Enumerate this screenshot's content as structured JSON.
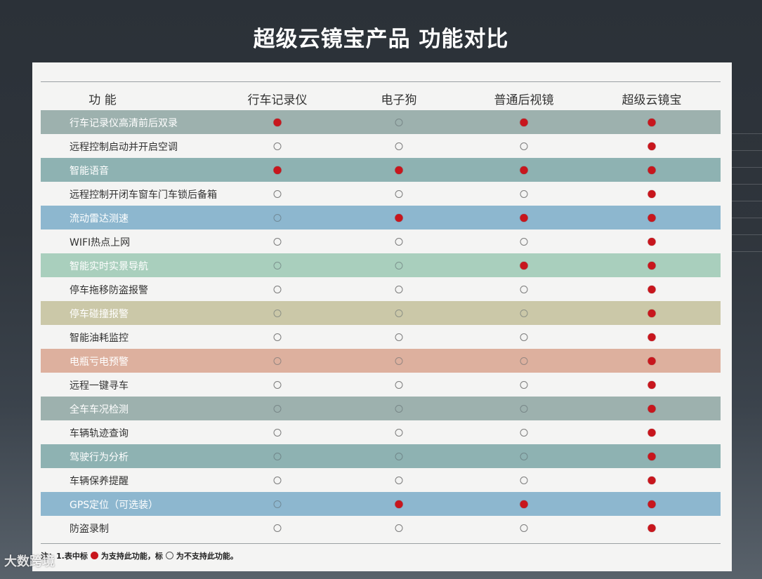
{
  "title": "超级云镜宝产品 功能对比",
  "table": {
    "columns": [
      "功 能",
      "行车记录仪",
      "电子狗",
      "普通后视镜",
      "超级云镜宝"
    ],
    "rows": [
      {
        "feature": "行车记录仪高清前后双录",
        "values": [
          true,
          false,
          true,
          true
        ],
        "color": "#9db1ae"
      },
      {
        "feature": "远程控制启动并开启空调",
        "values": [
          false,
          false,
          false,
          true
        ],
        "color": null
      },
      {
        "feature": "智能语音",
        "values": [
          true,
          true,
          true,
          true
        ],
        "color": "#8eb2b2"
      },
      {
        "feature": "远程控制开闭车窗车门车锁后备箱",
        "values": [
          false,
          false,
          false,
          true
        ],
        "color": null
      },
      {
        "feature": "流动雷达测速",
        "values": [
          false,
          true,
          true,
          true
        ],
        "color": "#8db7cf"
      },
      {
        "feature": "WIFI热点上网",
        "values": [
          false,
          false,
          false,
          true
        ],
        "color": null
      },
      {
        "feature": "智能实时实景导航",
        "values": [
          false,
          false,
          true,
          true
        ],
        "color": "#a9cfbd"
      },
      {
        "feature": "停车拖移防盗报警",
        "values": [
          false,
          false,
          false,
          true
        ],
        "color": null
      },
      {
        "feature": "停车碰撞报警",
        "values": [
          false,
          false,
          false,
          true
        ],
        "color": "#cbc8a8"
      },
      {
        "feature": "智能油耗监控",
        "values": [
          false,
          false,
          false,
          true
        ],
        "color": null
      },
      {
        "feature": "电瓶亏电预警",
        "values": [
          false,
          false,
          false,
          true
        ],
        "color": "#ddb09e"
      },
      {
        "feature": "远程一键寻车",
        "values": [
          false,
          false,
          false,
          true
        ],
        "color": null
      },
      {
        "feature": "全车车况检测",
        "values": [
          false,
          false,
          false,
          true
        ],
        "color": "#9db1ae"
      },
      {
        "feature": "车辆轨迹查询",
        "values": [
          false,
          false,
          false,
          true
        ],
        "color": null
      },
      {
        "feature": "驾驶行为分析",
        "values": [
          false,
          false,
          false,
          true
        ],
        "color": "#8eb2b2"
      },
      {
        "feature": "车辆保养提醒",
        "values": [
          false,
          false,
          false,
          true
        ],
        "color": null
      },
      {
        "feature": "GPS定位（可选装）",
        "values": [
          false,
          true,
          true,
          true
        ],
        "color": "#8db7cf"
      },
      {
        "feature": "防盗录制",
        "values": [
          false,
          false,
          false,
          true
        ],
        "color": null
      }
    ]
  },
  "note": {
    "prefix": "注：1.表中标",
    "supported": "为支持此功能，标",
    "unsupported": "为不支持此功能。"
  },
  "watermark": "大数跨境",
  "colors": {
    "supported_mark": "#c8161d",
    "panel": "#f4f4f3"
  }
}
